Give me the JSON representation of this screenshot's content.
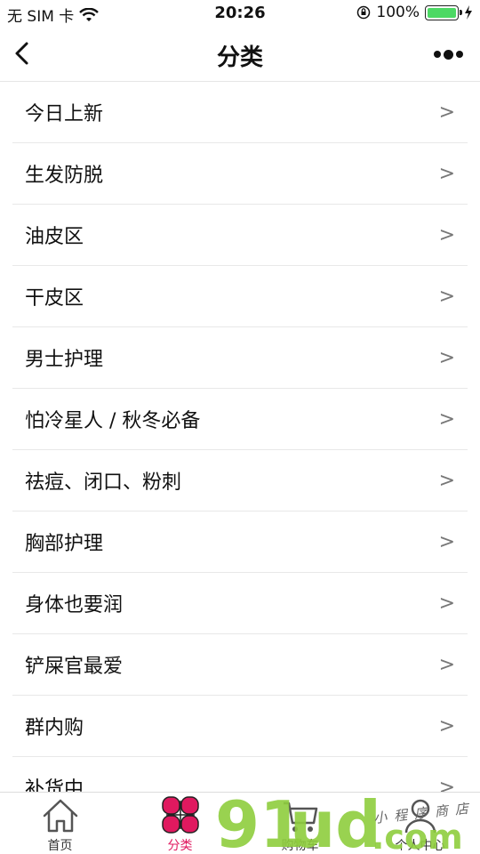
{
  "status_bar": {
    "carrier": "无 SIM 卡",
    "time": "20:26",
    "battery_percent": "100%",
    "battery_level": 1.0
  },
  "nav": {
    "title": "分类"
  },
  "categories": [
    {
      "label": "今日上新",
      "arrow": ">"
    },
    {
      "label": "生发防脱",
      "arrow": ">"
    },
    {
      "label": "油皮区",
      "arrow": ">"
    },
    {
      "label": "干皮区",
      "arrow": ">"
    },
    {
      "label": "男士护理",
      "arrow": ">"
    },
    {
      "label": "怕冷星人 / 秋冬必备",
      "arrow": ">"
    },
    {
      "label": "祛痘、闭口、粉刺",
      "arrow": ">"
    },
    {
      "label": "胸部护理",
      "arrow": ">"
    },
    {
      "label": "身体也要润",
      "arrow": ">"
    },
    {
      "label": "铲屎官最爱",
      "arrow": ">"
    },
    {
      "label": "群内购",
      "arrow": ">"
    },
    {
      "label": "补货中",
      "arrow": ">"
    }
  ],
  "tabs": [
    {
      "label": "首页",
      "icon": "home-icon",
      "active": false
    },
    {
      "label": "分类",
      "icon": "clover-icon",
      "active": true
    },
    {
      "label": "购物车",
      "icon": "cart-icon",
      "active": false
    },
    {
      "label": "个人中心",
      "icon": "user-icon",
      "active": false
    }
  ],
  "watermark": {
    "brand": "91",
    "brand_suffix": "ud",
    "domain": ".com",
    "tagline": "小程序商店"
  },
  "colors": {
    "accent": "#e0195f",
    "battery": "#4cd964",
    "watermark_green": "#8fce3e"
  }
}
